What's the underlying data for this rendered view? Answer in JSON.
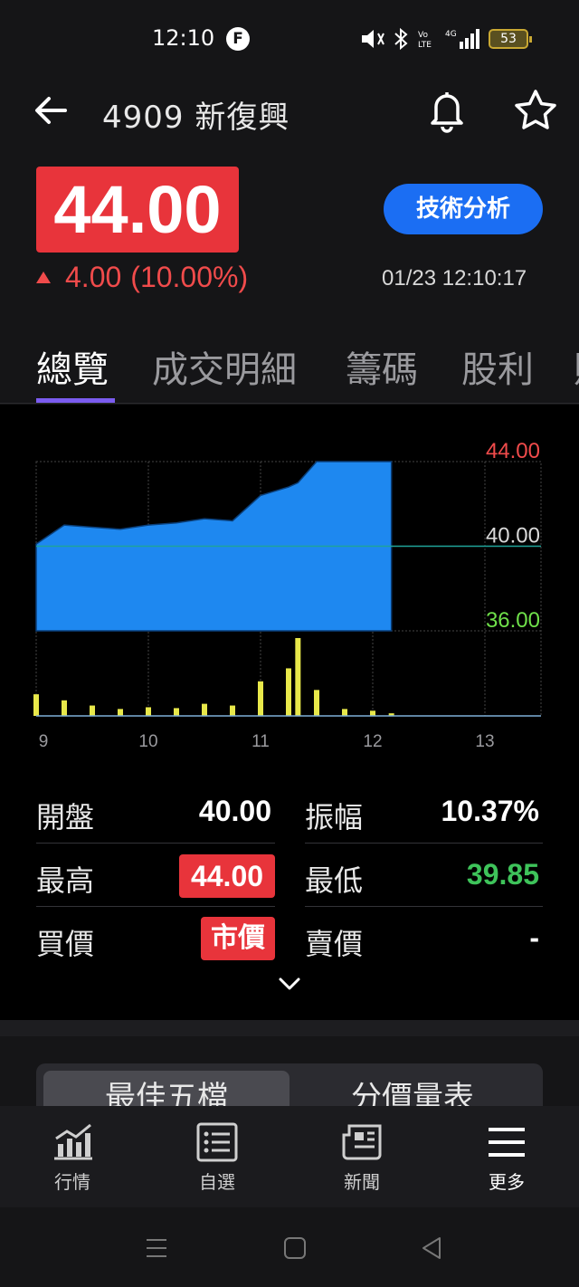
{
  "status_bar": {
    "time": "12:10",
    "f_badge": "F",
    "battery": "53"
  },
  "header": {
    "back_icon": "arrow-left-icon",
    "stock_code": "4909",
    "stock_name": "新復興",
    "title": "4909 新復興",
    "bell_icon": "bell-icon",
    "star_icon": "star-icon"
  },
  "quote": {
    "price": "44.00",
    "change": "4.00",
    "change_pct": "(10.00%)",
    "technical_button": "技術分析",
    "timestamp": "01/23 12:10:17"
  },
  "tabs": [
    {
      "label": "總覽"
    },
    {
      "label": "成交明細"
    },
    {
      "label": "籌碼"
    },
    {
      "label": "股利"
    }
  ],
  "chart_data": {
    "type": "area",
    "y_tick_labels": [
      "44.00",
      "40.00",
      "36.00"
    ],
    "x_tick_labels": [
      "9",
      "10",
      "11",
      "12",
      "13"
    ],
    "ylim": [
      36.0,
      44.0
    ],
    "reference_price": 40.0,
    "x": [
      "9:00",
      "9:15",
      "9:30",
      "9:45",
      "10:00",
      "10:15",
      "10:30",
      "10:45",
      "11:00",
      "11:15",
      "11:20",
      "11:30",
      "11:45",
      "12:00",
      "12:10"
    ],
    "price": [
      40.1,
      41.0,
      40.9,
      40.8,
      41.0,
      41.1,
      41.3,
      41.2,
      42.4,
      42.8,
      43.0,
      44.0,
      44.0,
      44.0,
      44.0
    ],
    "volume": [
      25,
      18,
      12,
      8,
      10,
      9,
      14,
      12,
      40,
      55,
      90,
      30,
      8,
      6,
      3
    ],
    "colors": {
      "price_fill": "#1e88f0",
      "volume": "#e8e84a",
      "high_label": "#f04b4b",
      "low_label": "#6fe04a",
      "ref_line": "#1fa39a"
    }
  },
  "stats": {
    "open_label": "開盤",
    "open_value": "40.00",
    "amplitude_label": "振幅",
    "amplitude_value": "10.37%",
    "high_label": "最高",
    "high_value": "44.00",
    "low_label": "最低",
    "low_value": "39.85",
    "bid_label": "買價",
    "bid_value": "市價",
    "ask_label": "賣價",
    "ask_value": "-",
    "expand_icon": "chevron-down-icon"
  },
  "order_book": {
    "tab_best5": "最佳五檔",
    "tab_price_volume": "分價量表"
  },
  "bottom_nav": [
    {
      "label": "行情",
      "icon": "chart-bars-icon"
    },
    {
      "label": "自選",
      "icon": "list-icon"
    },
    {
      "label": "新聞",
      "icon": "newspaper-icon"
    },
    {
      "label": "更多",
      "icon": "menu-icon"
    }
  ]
}
